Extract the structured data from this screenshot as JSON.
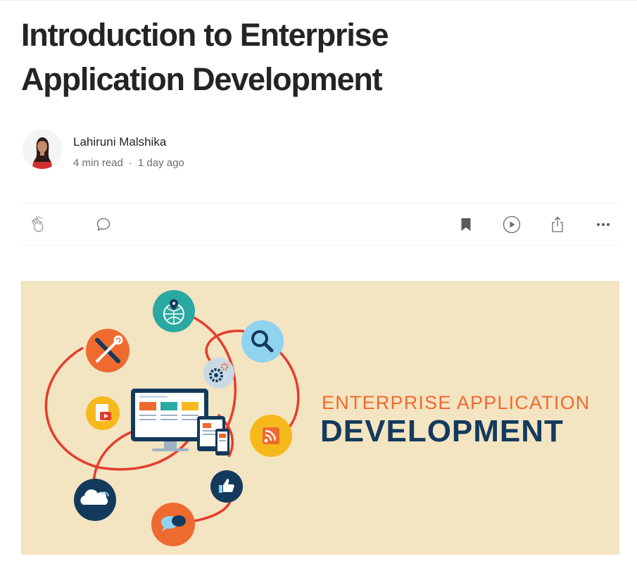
{
  "article": {
    "title": "Introduction to Enterprise Application Development"
  },
  "author": {
    "name": "Lahiruni Malshika",
    "read_time": "4 min read",
    "separator": "·",
    "published": "1 day ago"
  },
  "actions": {
    "clap_icon": "clap-icon",
    "comment_icon": "speech-bubble-icon",
    "bookmark_icon": "bookmark-icon",
    "listen_icon": "play-circle-icon",
    "share_icon": "share-icon",
    "more_icon": "more-horizontal-icon"
  },
  "hero": {
    "line1": "ENTERPRISE APPLICATION",
    "line2": "DEVELOPMENT",
    "colors": {
      "background": "#f3e4c2",
      "orange": "#ef6a2f",
      "navy": "#133a5c",
      "teal": "#2aa9a3",
      "red_line": "#e53d2d"
    }
  }
}
